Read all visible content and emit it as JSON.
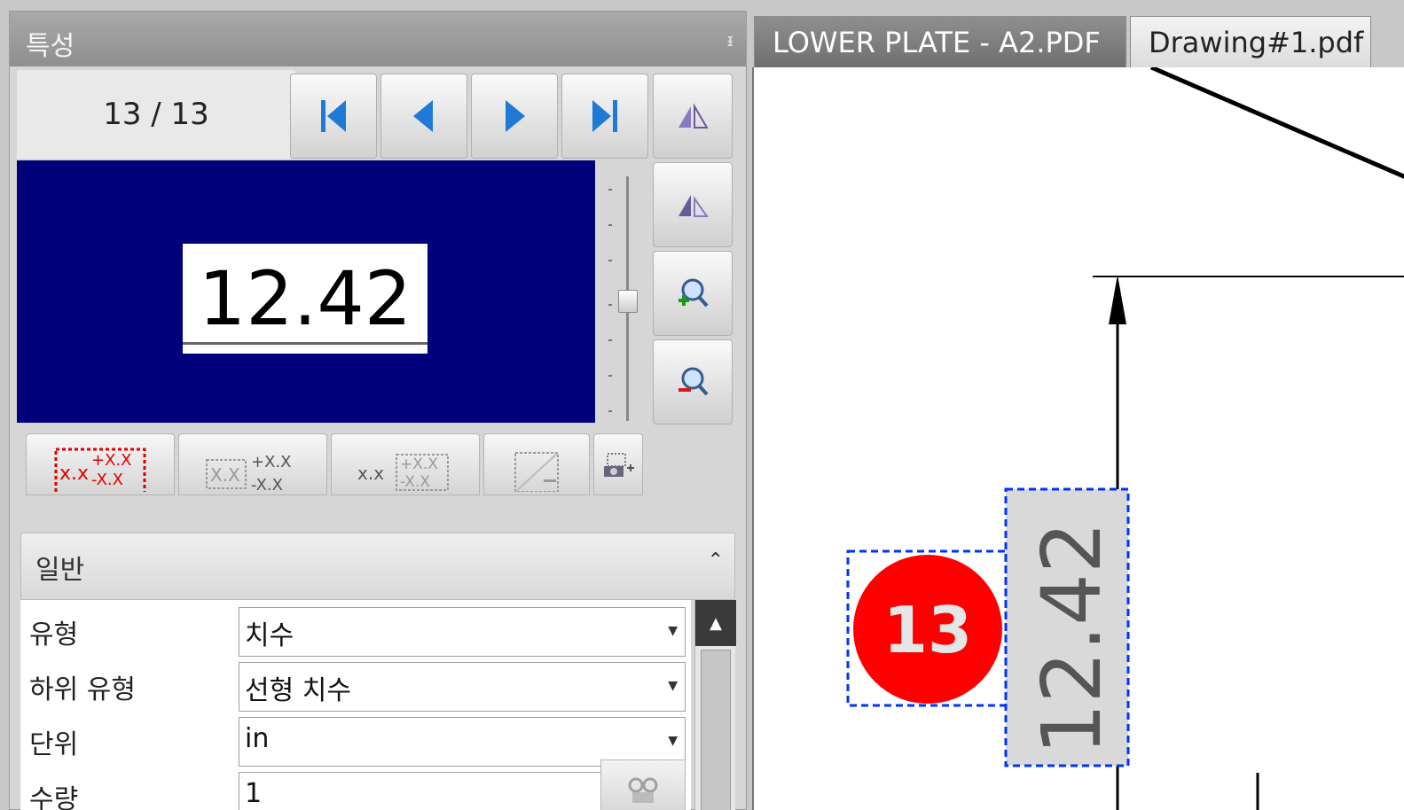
{
  "panel": {
    "title": "특성",
    "pin_icon": "pin-icon"
  },
  "navigator": {
    "counter": "13 / 13",
    "buttons": [
      "first-page-icon",
      "previous-icon",
      "next-icon",
      "last-page-icon"
    ],
    "side_buttons": [
      "flip-icon",
      "rotate-icon",
      "zoom-in-icon",
      "zoom-out-icon"
    ]
  },
  "preview": {
    "value": "12.42",
    "background": "#00007a"
  },
  "format_buttons": {
    "b1": {
      "base": "x.x",
      "plus": "+X.X",
      "minus": "-X.X"
    },
    "b2": {
      "base": "X.X",
      "plus": "+X.X",
      "minus": "-X.X"
    },
    "b3": {
      "base": "x.x",
      "plus": "+X.X",
      "minus": "-X.X"
    }
  },
  "section": {
    "title": "일반"
  },
  "properties": [
    {
      "label": "유형",
      "value": "치수"
    },
    {
      "label": "하위 유형",
      "value": "선형 치수"
    },
    {
      "label": "단위",
      "value": "in"
    },
    {
      "label": "수량",
      "value": "1"
    }
  ],
  "tabs": [
    {
      "label": "LOWER PLATE - A2.PDF",
      "active": true
    },
    {
      "label": "Drawing#1.pdf",
      "active": false
    }
  ],
  "drawing": {
    "balloon_number": "13",
    "balloon_color": "#ff0000",
    "dimension_text": "12.42",
    "selection_color": "#0033ff"
  }
}
